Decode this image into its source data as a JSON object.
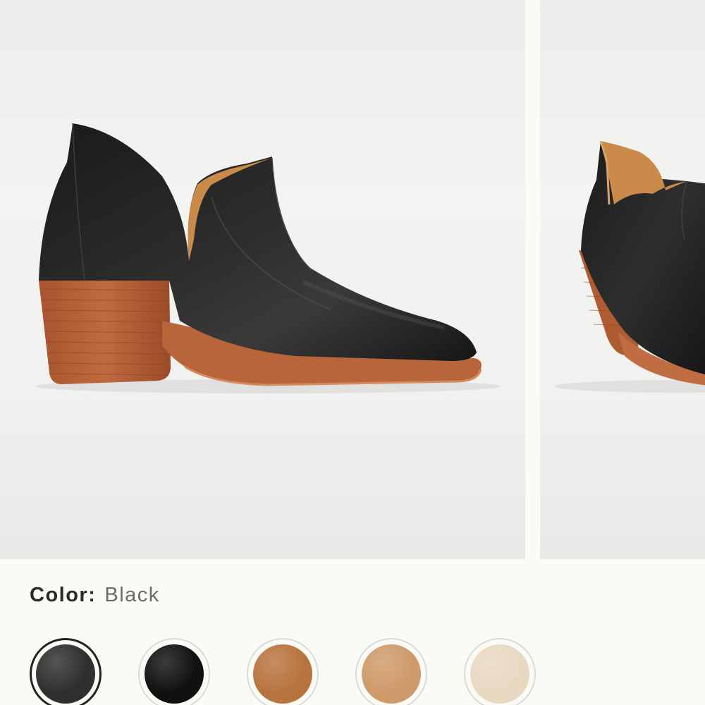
{
  "color_selector": {
    "label": "Color:",
    "selected_value": "Black"
  },
  "swatches": [
    {
      "name": "black-leather",
      "color": "#2f2f2f",
      "selected": true
    },
    {
      "name": "black-suede",
      "color": "#111111",
      "selected": false
    },
    {
      "name": "cognac",
      "color": "#b8743f",
      "selected": false
    },
    {
      "name": "tan",
      "color": "#cf9a6a",
      "selected": false
    },
    {
      "name": "cream",
      "color": "#e9d8c2",
      "selected": false
    }
  ]
}
